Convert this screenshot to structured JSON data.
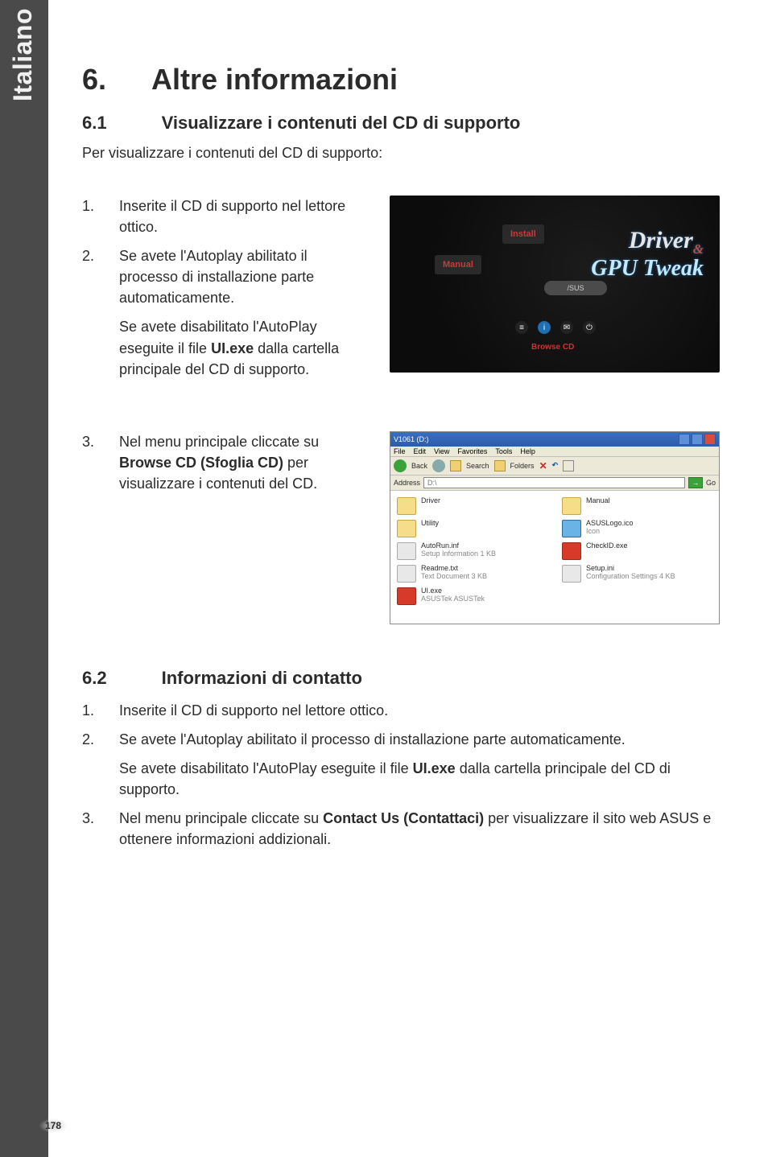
{
  "lang_tab": "Italiano",
  "page_number": "178",
  "h1": {
    "num": "6.",
    "title": "Altre informazioni"
  },
  "s61": {
    "num": "6.1",
    "title": "Visualizzare i contenuti del CD di supporto",
    "intro": "Per visualizzare i contenuti del CD di supporto:",
    "li1": {
      "num": "1.",
      "text": "Inserite il CD di supporto nel lettore ottico."
    },
    "li2": {
      "num": "2.",
      "p1a": "Se avete l'Autoplay abilitato il processo di installazione parte automaticamente.",
      "p2a": "Se avete disabilitato l'AutoPlay eseguite il file ",
      "p2b": "UI.exe",
      "p2c": " dalla cartella principale del CD di supporto."
    },
    "li3": {
      "num": "3.",
      "p1a": "Nel menu principale cliccate su ",
      "p1b": "Browse CD (Sfoglia CD)",
      "p1c": " per visualizzare i contenuti del CD."
    }
  },
  "installer": {
    "install": "Install",
    "manual": "Manual",
    "asus": "/SUS",
    "title_l1": "Driver",
    "title_amp": "&",
    "title_l2": "GPU Tweak",
    "browse": "Browse CD",
    "icon_bars": "≡",
    "icon_info": "i",
    "icon_mail": "✉",
    "icon_power": "⏻"
  },
  "explorer": {
    "title": "V1061 (D:)",
    "min": "_",
    "max": "▢",
    "close": "X",
    "menu": {
      "file": "File",
      "edit": "Edit",
      "view": "View",
      "fav": "Favorites",
      "tools": "Tools",
      "help": "Help"
    },
    "tb": {
      "back": "Back",
      "search": "Search",
      "folders": "Folders",
      "x": "✕",
      "undo": "↶"
    },
    "addr_label": "Address",
    "addr_value": "D:\\",
    "go": "Go",
    "items": [
      {
        "name": "Driver",
        "sub": "",
        "kind": "folder"
      },
      {
        "name": "Manual",
        "sub": "",
        "kind": "folder"
      },
      {
        "name": "Utility",
        "sub": "",
        "kind": "folder"
      },
      {
        "name": "ASUSLogo.ico",
        "sub": "Icon",
        "kind": "blue"
      },
      {
        "name": "AutoRun.inf",
        "sub": "Setup Information\n1 KB",
        "kind": "file"
      },
      {
        "name": "CheckID.exe",
        "sub": "",
        "kind": "red"
      },
      {
        "name": "Readme.txt",
        "sub": "Text Document\n3 KB",
        "kind": "file"
      },
      {
        "name": "Setup.ini",
        "sub": "Configuration Settings\n4 KB",
        "kind": "file"
      },
      {
        "name": "UI.exe",
        "sub": "ASUSTek\nASUSTek",
        "kind": "red"
      }
    ]
  },
  "s62": {
    "num": "6.2",
    "title": "Informazioni di contatto",
    "li1": {
      "num": "1.",
      "text": "Inserite il CD di supporto nel lettore ottico."
    },
    "li2": {
      "num": "2.",
      "p1": "Se avete l'Autoplay abilitato il processo di installazione parte automaticamente.",
      "p2a": "Se avete disabilitato l'AutoPlay eseguite il file ",
      "p2b": "UI.exe",
      "p2c": " dalla cartella principale del CD di supporto."
    },
    "li3": {
      "num": "3.",
      "p1a": "Nel menu principale cliccate su ",
      "p1b": "Contact Us (Contattaci)",
      "p1c": " per visualizzare il sito web ASUS e ottenere informazioni addizionali."
    }
  }
}
